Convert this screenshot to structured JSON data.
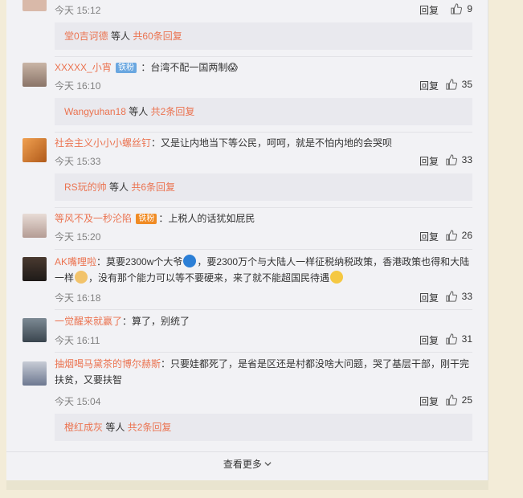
{
  "top": {
    "time": "今天 15:12",
    "reply": "回复",
    "likes": "9"
  },
  "sub0": {
    "user": "堂0吉诃德",
    "mid": "等人",
    "count": "共60条回复"
  },
  "comments": [
    {
      "user": "XXXXX_小宵",
      "badge": "铁粉",
      "text": "：台湾不配一国两制😱",
      "time": "今天 16:10",
      "reply": "回复",
      "likes": "35",
      "sub": {
        "user": "Wangyuhan18",
        "mid": "等人",
        "count": "共2条回复"
      }
    },
    {
      "user": "社会主义小小小螺丝钉",
      "text": "：又是让内地当下等公民，呵呵，就是不怕内地的会哭呗",
      "time": "今天 15:33",
      "reply": "回复",
      "likes": "33",
      "sub": {
        "user": "RS玩的帅",
        "mid": "等人",
        "count": "共6条回复"
      }
    },
    {
      "user": "等风不及一秒沦陷",
      "badge": "铁粉",
      "text": "：上税人的话犹如屁民",
      "time": "今天 15:20",
      "reply": "回复",
      "likes": "26"
    },
    {
      "user": "AK嘴哩啦",
      "text1": "：莫要2300w个大爷",
      "text2": "，要2300万个与大陆人一样征税纳税政策，香港政策也得和大陆",
      "text3": "一样",
      "text4": "，没有那个能力可以等不要硬来，来了就不能超国民待遇",
      "time": "今天 16:18",
      "reply": "回复",
      "likes": "33"
    },
    {
      "user": "一觉醒来就赢了",
      "text": "：算了，别统了",
      "time": "今天 16:11",
      "reply": "回复",
      "likes": "31"
    },
    {
      "user": "抽烟喝马黛茶的博尔赫斯",
      "text1": "：只要娃都死了，是省是区还是村都没啥大问题，哭了基层干部，刚干完",
      "text2": "扶贫，又要扶智",
      "time": "今天 15:04",
      "reply": "回复",
      "likes": "25",
      "sub": {
        "user": "橙红成灰",
        "mid": "等人",
        "count": "共2条回复"
      }
    }
  ],
  "more": {
    "label": "查看更多",
    "icon": "chevron-down-icon"
  }
}
